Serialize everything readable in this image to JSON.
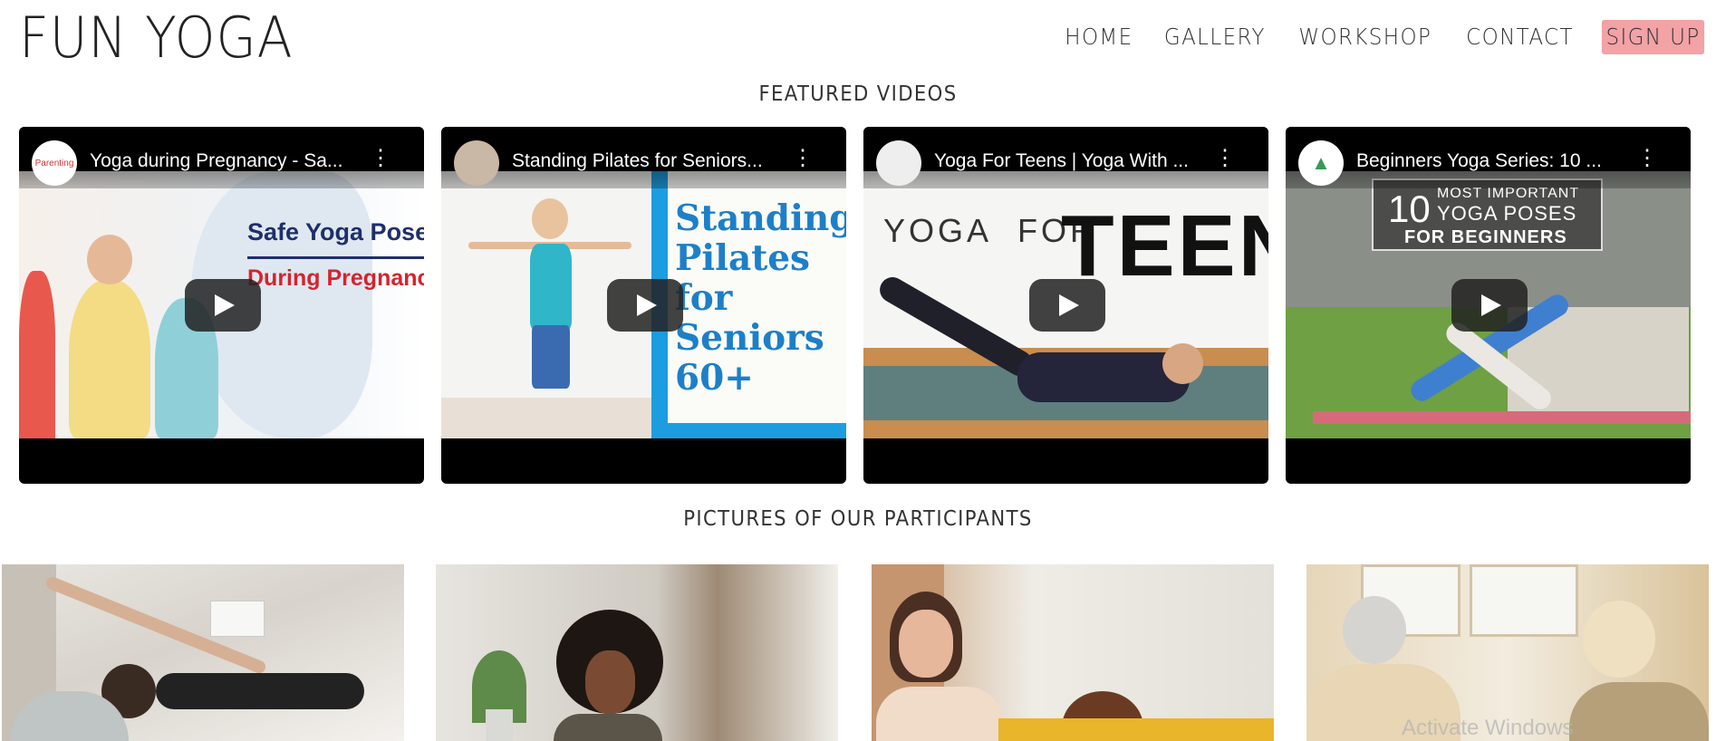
{
  "header": {
    "logo": "FUN YOGA",
    "nav": [
      {
        "label": "HOME"
      },
      {
        "label": "GALLERY"
      },
      {
        "label": "WORKSHOP"
      },
      {
        "label": "CONTACT"
      },
      {
        "label": "SIGN UP"
      }
    ],
    "signup_color": "#f3a2a6"
  },
  "featured": {
    "title": "FEATURED VIDEOS",
    "videos": [
      {
        "title": "Yoga during Pregnancy - Sa...",
        "channel_badge": "Parenting",
        "thumb_text_1": "Safe Yoga Pose",
        "thumb_text_2": "During Pregnanc"
      },
      {
        "title": "Standing Pilates for Seniors...",
        "thumb_text_1": "Standing",
        "thumb_text_2": "Pilates",
        "thumb_text_3": "for",
        "thumb_text_4": "Seniors",
        "thumb_text_5": "60+"
      },
      {
        "title": "Yoga For Teens | Yoga With ...",
        "thumb_text_1": "YOGA",
        "thumb_text_2": "FOR",
        "thumb_text_3": "TEENS"
      },
      {
        "title": "Beginners Yoga Series: 10 ...",
        "thumb_text_1": "10",
        "thumb_text_2": "MOST IMPORTANT",
        "thumb_text_3": "YOGA POSES",
        "thumb_text_4": "FOR BEGINNERS"
      }
    ]
  },
  "participants": {
    "title": "PICTURES OF OUR PARTICIPANTS"
  },
  "os_watermark": "Activate Windows"
}
